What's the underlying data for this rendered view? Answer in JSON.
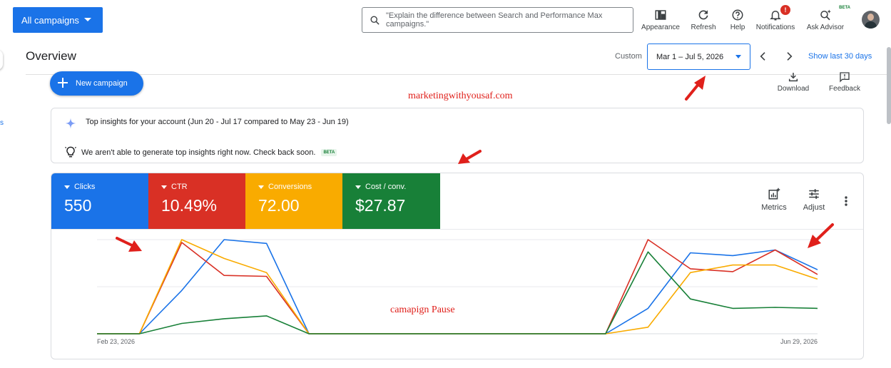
{
  "header": {
    "campaign_select": "All campaigns",
    "search_placeholder": "\"Explain the difference between Search and Performance Max campaigns.\"",
    "tools": [
      {
        "label": "Appearance",
        "icon": "appearance-icon"
      },
      {
        "label": "Refresh",
        "icon": "refresh-icon"
      },
      {
        "label": "Help",
        "icon": "help-icon"
      },
      {
        "label": "Notifications",
        "icon": "bell-icon",
        "badge": "!"
      },
      {
        "label": "Ask Advisor",
        "icon": "advisor-icon",
        "sup": "BETA"
      }
    ]
  },
  "left_stub_text": "s",
  "overview": {
    "title": "Overview",
    "custom_label": "Custom",
    "date_range": "Mar 1 – Jul 5, 2026",
    "show_last": "Show last 30 days"
  },
  "actions": {
    "new_campaign": "New campaign",
    "download": "Download",
    "feedback": "Feedback"
  },
  "annotations": {
    "watermark": "marketingwithyousaf.com",
    "pause_note": "camapign Pause"
  },
  "insights": {
    "title": "Top insights for your account (Jun 20 - Jul 17 compared to May 23 - Jun 19)",
    "message": "We aren't able to generate top insights right now. Check back soon.",
    "beta": "BETA"
  },
  "metrics": [
    {
      "label": "Clicks",
      "value": "550",
      "color": "#1a73e8"
    },
    {
      "label": "CTR",
      "value": "10.49%",
      "color": "#d93025"
    },
    {
      "label": "Conversions",
      "value": "72.00",
      "color": "#f9ab00"
    },
    {
      "label": "Cost / conv.",
      "value": "$27.87",
      "color": "#188038"
    }
  ],
  "chart_tools": {
    "metrics": "Metrics",
    "adjust": "Adjust"
  },
  "chart_data": {
    "type": "line",
    "x_start_label": "Feb 23, 2026",
    "x_end_label": "Jun 29, 2026",
    "ylim": [
      0,
      100
    ],
    "grid": true,
    "series": [
      {
        "name": "Clicks",
        "color": "#1a73e8",
        "values": [
          0,
          0,
          46,
          100,
          96,
          0,
          0,
          0,
          0,
          0,
          0,
          0,
          0,
          27,
          86,
          83,
          89,
          68
        ]
      },
      {
        "name": "CTR",
        "color": "#d93025",
        "values": [
          0,
          0,
          97,
          62,
          61,
          0,
          0,
          0,
          0,
          0,
          0,
          0,
          0,
          100,
          69,
          66,
          89,
          63
        ]
      },
      {
        "name": "Conversions",
        "color": "#f9ab00",
        "values": [
          0,
          0,
          100,
          80,
          65,
          0,
          0,
          0,
          0,
          0,
          0,
          0,
          0,
          7,
          65,
          73,
          73,
          58
        ]
      },
      {
        "name": "Cost / conv.",
        "color": "#188038",
        "values": [
          0,
          0,
          11,
          16,
          19,
          0,
          0,
          0,
          0,
          0,
          0,
          0,
          0,
          87,
          37,
          27,
          28,
          27
        ]
      }
    ]
  }
}
